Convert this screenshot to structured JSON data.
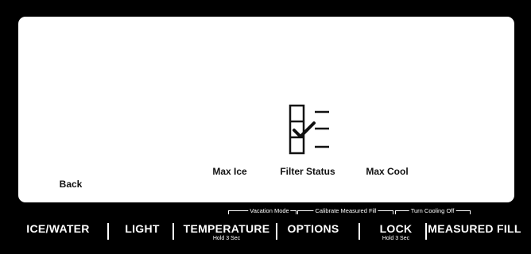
{
  "display": {
    "back_label": "Back",
    "max_ice_label": "Max Ice",
    "filter_status_label": "Filter Status",
    "max_cool_label": "Max Cool"
  },
  "hold_functions": {
    "vacation_mode": "Vacation Mode",
    "calibrate_measured_fill": "Calibrate Measured Fill",
    "turn_cooling_off": "Turn Cooling Off"
  },
  "buttons": {
    "ice_water": "ICE/WATER",
    "light": "LIGHT",
    "temperature": "TEMPERATURE",
    "temperature_hold": "Hold 3 Sec",
    "options": "OPTIONS",
    "lock": "LOCK",
    "lock_hold": "Hold 3 Sec",
    "measured_fill": "MEASURED FILL"
  },
  "colors": {
    "panel_background": "#000000",
    "display_background": "#ffffff"
  }
}
